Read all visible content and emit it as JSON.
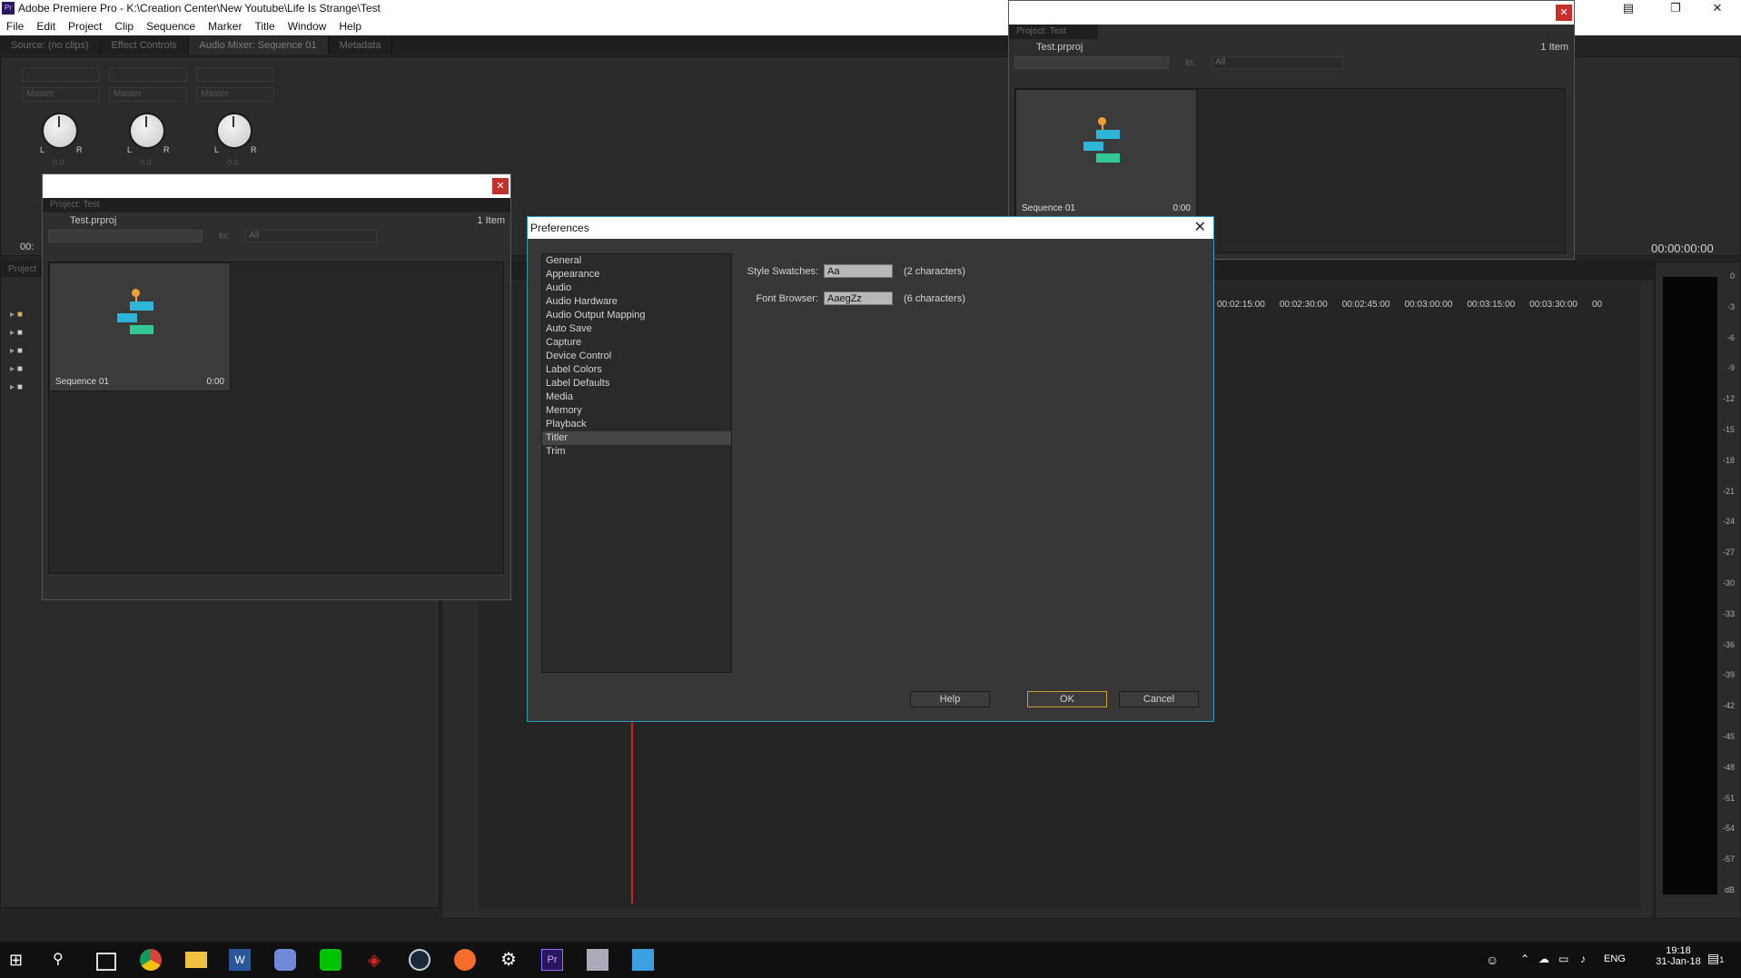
{
  "app": {
    "title": "Adobe Premiere Pro - K:\\Creation Center\\New Youtube\\Life Is Strange\\Test",
    "icon": "Pr"
  },
  "menu": [
    "File",
    "Edit",
    "Project",
    "Clip",
    "Sequence",
    "Marker",
    "Title",
    "Window",
    "Help"
  ],
  "source_tabs": [
    "Source: (no clips)",
    "Effect Controls",
    "Audio Mixer: Sequence 01",
    "Metadata"
  ],
  "audio_mixer": {
    "tracks": [
      {
        "output": "Master",
        "value": "0.0"
      },
      {
        "output": "Master",
        "value": "0.0"
      },
      {
        "output": "Master",
        "value": "0.0"
      }
    ],
    "l": "L",
    "r": "R"
  },
  "project_windows": [
    {
      "tab": "Project: Test",
      "file": "Test.prproj",
      "count": "1 Item",
      "in_label": "In:",
      "in_value": "All",
      "item_name": "Sequence 01",
      "item_duration": "0:00"
    },
    {
      "tab": "Project: Test",
      "file": "Test.prproj",
      "count": "1 Item",
      "in_label": "In:",
      "in_value": "All",
      "item_name": "Sequence 01",
      "item_duration": "0:00"
    }
  ],
  "left_project": {
    "tab": "Project"
  },
  "timecodes": {
    "program": "00:00:00:00",
    "left_partial": "00:",
    "ruler": [
      "00:02:15:00",
      "00:02:30:00",
      "00:02:45:00",
      "00:03:00:00",
      "00:03:15:00",
      "00:03:30:00",
      "00"
    ]
  },
  "meter_labels": [
    "0",
    "-3",
    "-6",
    "-9",
    "-12",
    "-15",
    "-18",
    "-21",
    "-24",
    "-27",
    "-30",
    "-33",
    "-36",
    "-39",
    "-42",
    "-45",
    "-48",
    "-51",
    "-54",
    "-57",
    "dB"
  ],
  "preferences": {
    "title": "Preferences",
    "categories": [
      "General",
      "Appearance",
      "Audio",
      "Audio Hardware",
      "Audio Output Mapping",
      "Auto Save",
      "Capture",
      "Device Control",
      "Label Colors",
      "Label Defaults",
      "Media",
      "Memory",
      "Playback",
      "Titler",
      "Trim"
    ],
    "selected": "Titler",
    "style_swatches_label": "Style Swatches:",
    "style_swatches_value": "Aa",
    "style_swatches_count": "(2 characters)",
    "font_browser_label": "Font Browser:",
    "font_browser_value": "AaegZz",
    "font_browser_count": "(6 characters)",
    "help_label": "Help",
    "ok_label": "OK",
    "cancel_label": "Cancel"
  },
  "taskbar": {
    "time": "19:18",
    "date": "31-Jan-18",
    "lang": "ENG",
    "notif_count": "1",
    "apps": [
      "windows-start-icon",
      "search-icon",
      "task-view-icon",
      "chrome-icon",
      "file-explorer-icon",
      "word-icon",
      "discord-icon",
      "line-icon",
      "razer-icon",
      "steam-icon",
      "origin-icon",
      "settings-icon",
      "premiere-icon",
      "app-icon",
      "app-icon"
    ]
  },
  "colors": {
    "accent": "#2a9bb5",
    "ok_border": "#d09a28",
    "close": "#c4302b",
    "playhead": "#d02020"
  }
}
